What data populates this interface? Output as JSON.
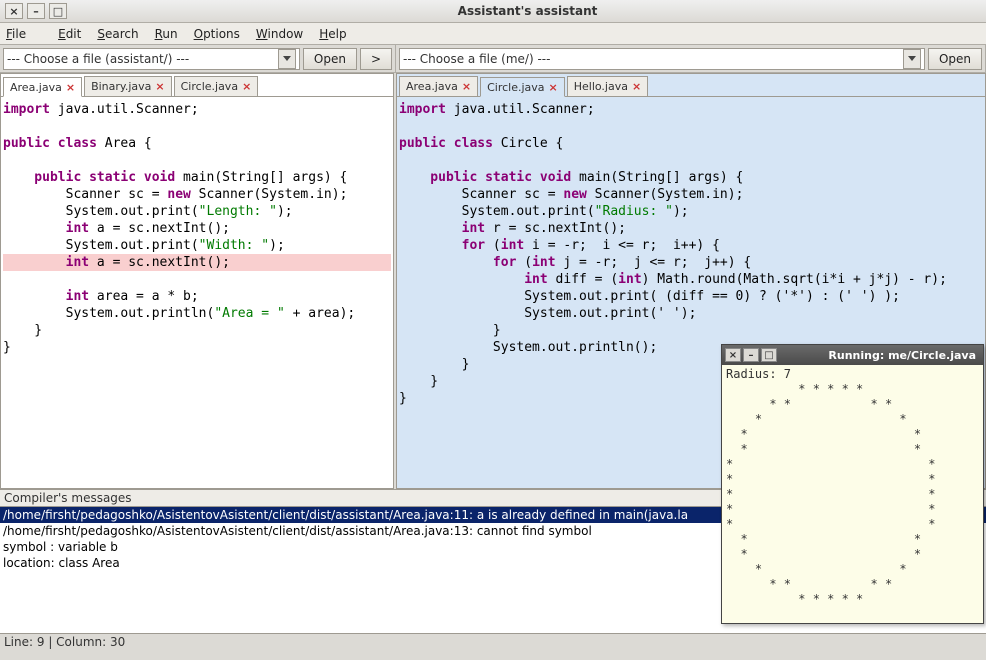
{
  "window": {
    "title": "Assistant's assistant",
    "close_label": "×",
    "min_label": "–",
    "max_label": "□"
  },
  "menu": {
    "file": "File",
    "edit": "Edit",
    "search": "Search",
    "run": "Run",
    "options": "Options",
    "window": "Window",
    "help": "Help"
  },
  "toolbar_left": {
    "combo_text": "--- Choose a file (assistant/) ---",
    "open": "Open",
    "forward": ">"
  },
  "toolbar_right": {
    "combo_text": "--- Choose a file (me/) ---",
    "open": "Open"
  },
  "left_pane": {
    "tabs": [
      {
        "label": "Area.java",
        "active": true
      },
      {
        "label": "Binary.java",
        "active": false
      },
      {
        "label": "Circle.java",
        "active": false
      }
    ]
  },
  "right_pane": {
    "tabs": [
      {
        "label": "Area.java",
        "active": false
      },
      {
        "label": "Circle.java",
        "active": true
      },
      {
        "label": "Hello.java",
        "active": false
      }
    ]
  },
  "compiler": {
    "label": "Compiler's messages",
    "lines": [
      "/home/firsht/pedagoshko/AsistentovAsistent/client/dist/assistant/Area.java:11: a is already defined in main(java.la",
      "/home/firsht/pedagoshko/AsistentovAsistent/client/dist/assistant/Area.java:13: cannot find symbol",
      "symbol  : variable b",
      "location: class Area"
    ]
  },
  "statusbar": "Line: 9 | Column: 30",
  "popup": {
    "title": "Running: me/Circle.java",
    "close_label": "×",
    "min_label": "–",
    "max_label": "□",
    "output": "Radius: 7\n          * * * * *\n      * *           * *\n    *                   *\n  *                       *\n  *                       *\n*                           *\n*                           *\n*                           *\n*                           *\n*                           *\n  *                       *\n  *                       *\n    *                   *\n      * *           * *\n          * * * * *"
  },
  "left_code": {
    "l1": "import",
    "l1b": " java.util.Scanner;",
    "l3a": "public class",
    "l3b": " Area {",
    "l5a": "    public static void",
    "l5b": " main(String[] args) {",
    "l6a": "        Scanner sc = ",
    "l6b": "new",
    "l6c": " Scanner(System.in);",
    "l7a": "        System.out.print(",
    "l7b": "\"Length: \"",
    "l7c": ");",
    "l8a": "        int",
    "l8b": " a = sc.nextInt();",
    "l9a": "        System.out.print(",
    "l9b": "\"Width: \"",
    "l9c": ");",
    "l10a": "        int",
    "l10b": " a = sc.nextInt();",
    "l12a": "        int",
    "l12b": " area = a * b;",
    "l13a": "        System.out.println(",
    "l13b": "\"Area = \"",
    "l13c": " + area);",
    "l14": "    }",
    "l15": "}"
  },
  "right_code": {
    "l1": "import",
    "l1b": " java.util.Scanner;",
    "l3a": "public class",
    "l3b": " Circle {",
    "l5a": "    public static void",
    "l5b": " main(String[] args) {",
    "l6a": "        Scanner sc = ",
    "l6b": "new",
    "l6c": " Scanner(System.in);",
    "l7a": "        System.out.print(",
    "l7b": "\"Radius: \"",
    "l7c": ");",
    "l8a": "        int",
    "l8b": " r = sc.nextInt();",
    "l9a": "        for",
    "l9b": " (",
    "l9c": "int",
    "l9d": " i = -r;  i <= r;  i++) {",
    "l10a": "            for",
    "l10b": " (",
    "l10c": "int",
    "l10d": " j = -r;  j <= r;  j++) {",
    "l11a": "                int",
    "l11b": " diff = (",
    "l11c": "int",
    "l11d": ") Math.round(Math.sqrt(i*i + j*j) - r);",
    "l12": "                System.out.print( (diff == 0) ? ('*') : (' ') );",
    "l13": "                System.out.print(' ');",
    "l14": "            }",
    "l15": "            System.out.println();",
    "l16": "        }",
    "l17": "    }",
    "l18": "}"
  }
}
